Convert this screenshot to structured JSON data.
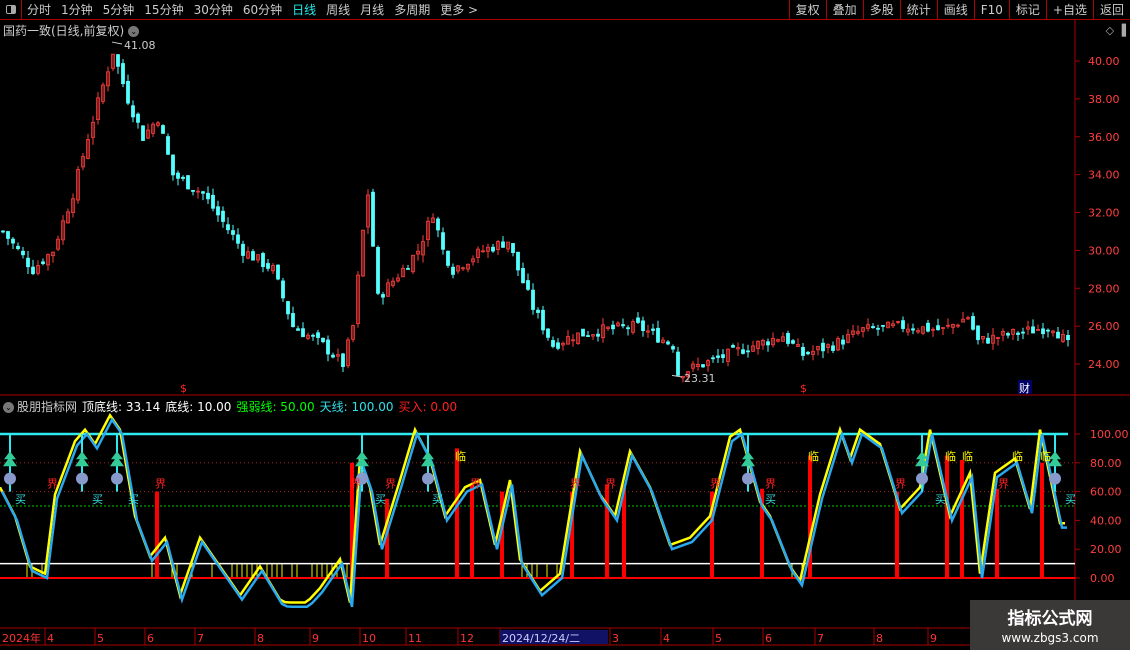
{
  "toolbar": {
    "periods": [
      "分时",
      "1分钟",
      "5分钟",
      "15分钟",
      "30分钟",
      "60分钟",
      "日线",
      "周线",
      "月线",
      "多周期",
      "更多 >"
    ],
    "active_period": "日线",
    "buttons": [
      "复权",
      "叠加",
      "多股",
      "统计",
      "画线",
      "F10",
      "标记",
      "+自选",
      "返回"
    ]
  },
  "main_chart": {
    "title": "国药一致(日线,前复权)",
    "high_label": "41.08",
    "low_label": "23.31",
    "y_ticks": [
      "40.00",
      "38.00",
      "36.00",
      "34.00",
      "32.00",
      "30.00",
      "28.00",
      "26.00",
      "24.00"
    ],
    "markers": [
      "$",
      "$",
      "财"
    ],
    "colors": {
      "up": "#ff3c3c",
      "down": "#54ffff"
    }
  },
  "indicator": {
    "name": "股朋指标网",
    "values": [
      {
        "label": "顶底线: 33.14",
        "color": "#ffffff"
      },
      {
        "label": "底线: 10.00",
        "color": "#ffffff"
      },
      {
        "label": "强弱线: 50.00",
        "color": "#00ff00"
      },
      {
        "label": "天线: 100.00",
        "color": "#30e0e8"
      },
      {
        "label": "买入: 0.00",
        "color": "#ff2020"
      }
    ],
    "y_ticks": [
      "100.00",
      "80.00",
      "60.00",
      "40.00",
      "20.00",
      "0.00"
    ],
    "signal_texts": {
      "boundary": "界",
      "near": "临",
      "buy": "买"
    }
  },
  "date_axis": {
    "labels": [
      "2024年",
      "4",
      "5",
      "6",
      "7",
      "8",
      "9",
      "10",
      "11",
      "12",
      "2024/12/24/二",
      "3",
      "4",
      "5",
      "6",
      "7",
      "8",
      "9"
    ]
  },
  "watermark": {
    "line1": "指标公式网",
    "line2": "www.zbgs3.com"
  },
  "chart_data": {
    "type": "candlestick",
    "price_ylim": [
      23,
      41.5
    ],
    "price_path": [
      [
        0,
        31
      ],
      [
        6,
        29
      ],
      [
        10,
        30
      ],
      [
        14,
        33
      ],
      [
        17,
        36
      ],
      [
        22,
        40.5
      ],
      [
        25,
        38
      ],
      [
        28,
        36
      ],
      [
        31,
        37
      ],
      [
        34,
        34
      ],
      [
        40,
        33
      ],
      [
        48,
        30
      ],
      [
        54,
        29
      ],
      [
        58,
        26
      ],
      [
        64,
        25
      ],
      [
        68,
        24
      ],
      [
        70,
        26
      ],
      [
        72,
        31
      ],
      [
        73,
        33
      ],
      [
        75,
        27.5
      ],
      [
        80,
        29
      ],
      [
        83,
        30
      ],
      [
        86,
        32
      ],
      [
        88,
        30
      ],
      [
        90,
        29
      ],
      [
        96,
        30
      ],
      [
        101,
        30.5
      ],
      [
        103,
        29
      ],
      [
        106,
        27
      ],
      [
        110,
        25
      ],
      [
        114,
        25.5
      ],
      [
        120,
        25.8
      ],
      [
        127,
        26
      ],
      [
        134,
        25
      ],
      [
        135,
        23.5
      ],
      [
        140,
        24
      ],
      [
        148,
        24.8
      ],
      [
        156,
        25.5
      ],
      [
        160,
        24.5
      ],
      [
        166,
        25
      ],
      [
        172,
        25.8
      ],
      [
        180,
        26
      ],
      [
        188,
        25.8
      ],
      [
        193,
        26.5
      ],
      [
        195,
        25.2
      ],
      [
        200,
        25.5
      ],
      [
        210,
        26
      ],
      [
        213,
        25
      ]
    ],
    "oscillator_ylim": [
      0,
      100
    ],
    "oscillator_path": [
      [
        0,
        60
      ],
      [
        3,
        40
      ],
      [
        6,
        5
      ],
      [
        9,
        0
      ],
      [
        11,
        55
      ],
      [
        15,
        92
      ],
      [
        17,
        100
      ],
      [
        19,
        90
      ],
      [
        22,
        110
      ],
      [
        24,
        100
      ],
      [
        27,
        40
      ],
      [
        30,
        12
      ],
      [
        33,
        25
      ],
      [
        36,
        -15
      ],
      [
        40,
        25
      ],
      [
        44,
        5
      ],
      [
        48,
        -15
      ],
      [
        52,
        5
      ],
      [
        56,
        -18
      ],
      [
        60,
        -25
      ],
      [
        64,
        -10
      ],
      [
        68,
        10
      ],
      [
        70,
        -20
      ],
      [
        72,
        80
      ],
      [
        74,
        60
      ],
      [
        76,
        20
      ],
      [
        80,
        65
      ],
      [
        83,
        100
      ],
      [
        86,
        80
      ],
      [
        89,
        40
      ],
      [
        93,
        60
      ],
      [
        96,
        65
      ],
      [
        99,
        20
      ],
      [
        102,
        65
      ],
      [
        104,
        10
      ],
      [
        108,
        -12
      ],
      [
        112,
        0
      ],
      [
        116,
        85
      ],
      [
        120,
        55
      ],
      [
        123,
        40
      ],
      [
        126,
        85
      ],
      [
        130,
        60
      ],
      [
        134,
        20
      ],
      [
        138,
        25
      ],
      [
        142,
        40
      ],
      [
        146,
        95
      ],
      [
        148,
        100
      ],
      [
        152,
        50
      ],
      [
        154,
        40
      ],
      [
        158,
        5
      ],
      [
        160,
        -5
      ],
      [
        164,
        55
      ],
      [
        168,
        100
      ],
      [
        170,
        80
      ],
      [
        172,
        100
      ],
      [
        176,
        90
      ],
      [
        180,
        45
      ],
      [
        184,
        60
      ],
      [
        186,
        100
      ],
      [
        190,
        40
      ],
      [
        194,
        70
      ],
      [
        196,
        0
      ],
      [
        199,
        70
      ],
      [
        203,
        80
      ],
      [
        206,
        45
      ],
      [
        208,
        100
      ],
      [
        212,
        35
      ]
    ],
    "levels": {
      "sky": 100,
      "strong_weak": 50,
      "bottom": 10,
      "zero": 0
    }
  }
}
